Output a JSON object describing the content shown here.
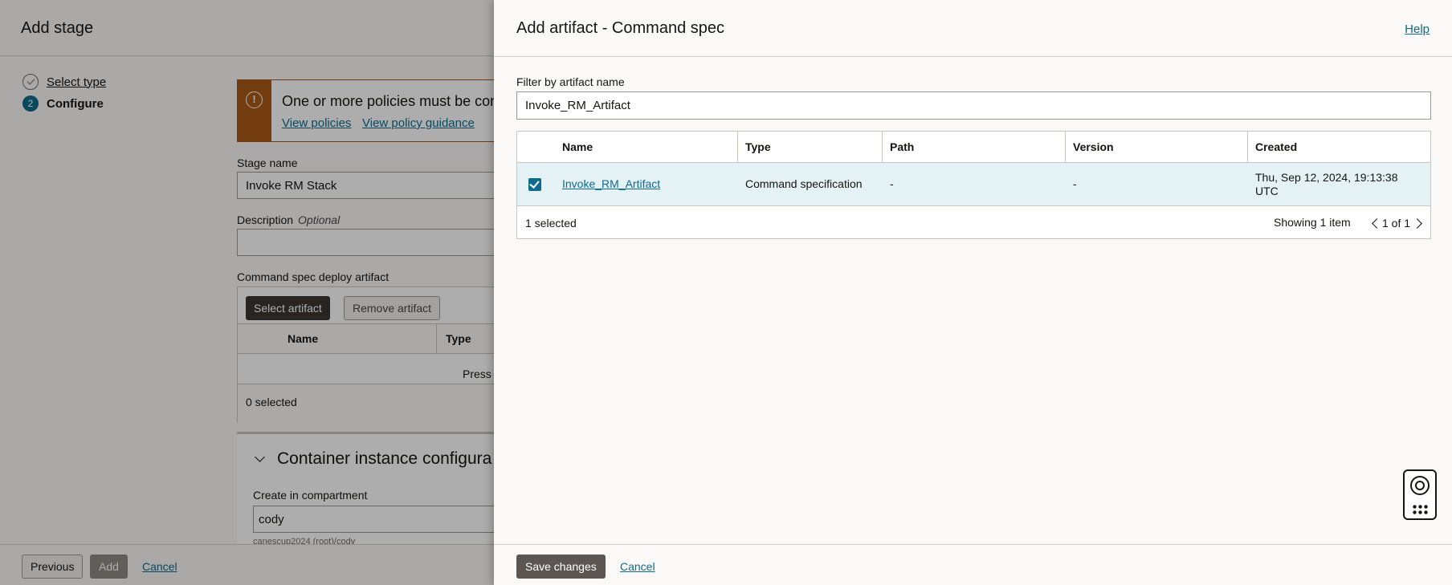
{
  "background": {
    "title": "Add stage",
    "steps": [
      {
        "label": "Select type",
        "state": "done"
      },
      {
        "number": "2",
        "label": "Configure",
        "state": "current"
      }
    ],
    "policy_warning": {
      "message": "One or more policies must be confi",
      "view_policies": "View policies",
      "view_guidance": "View policy guidance"
    },
    "stage_name": {
      "label": "Stage name",
      "value": "Invoke RM Stack"
    },
    "description": {
      "label": "Description",
      "optional": "Optional",
      "value": ""
    },
    "artifact_section": {
      "label": "Command spec deploy artifact",
      "select_button": "Select artifact",
      "remove_button": "Remove artifact",
      "columns": [
        "Name",
        "Type"
      ],
      "empty_text": "Press",
      "selected_count": "0 selected"
    },
    "container_section": {
      "title": "Container instance configura",
      "compartment_label": "Create in compartment",
      "compartment_value": "cody",
      "compartment_path": "canescup2024 (root)/cody"
    },
    "footer": {
      "previous": "Previous",
      "add": "Add",
      "cancel": "Cancel"
    }
  },
  "drawer": {
    "title": "Add artifact - Command spec",
    "help": "Help",
    "filter": {
      "label": "Filter by artifact name",
      "value": "Invoke_RM_Artifact"
    },
    "table": {
      "columns": [
        "Name",
        "Type",
        "Path",
        "Version",
        "Created"
      ],
      "rows": [
        {
          "selected": true,
          "name": "Invoke_RM_Artifact",
          "type": "Command specification",
          "path": "-",
          "version": "-",
          "created": "Thu, Sep 12, 2024, 19:13:38 UTC"
        }
      ],
      "selected_count": "1 selected",
      "showing": "Showing 1 item",
      "page": "1 of 1"
    },
    "footer": {
      "save": "Save changes",
      "cancel": "Cancel"
    }
  },
  "colors": {
    "accent": "#0e6b8c",
    "warning": "#ac5a19",
    "dark_button": "#3a3631"
  },
  "icons": [
    "check-circle-icon",
    "warning-icon",
    "chevron-down-icon",
    "checkbox-checked-icon",
    "chevron-left-icon",
    "chevron-right-icon",
    "lifebuoy-icon",
    "apps-grid-icon"
  ]
}
